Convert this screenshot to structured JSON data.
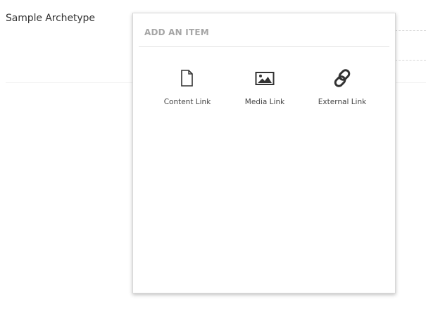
{
  "property": {
    "label": "Sample Archetype"
  },
  "dialog": {
    "title": "ADD AN ITEM",
    "items": [
      {
        "label": "Content Link",
        "icon": "document-icon"
      },
      {
        "label": "Media Link",
        "icon": "picture-icon"
      },
      {
        "label": "External Link",
        "icon": "chain-link-icon"
      }
    ]
  },
  "colors": {
    "title_text": "#a6a6a6",
    "label_text": "#444444",
    "icon": "#333333"
  }
}
